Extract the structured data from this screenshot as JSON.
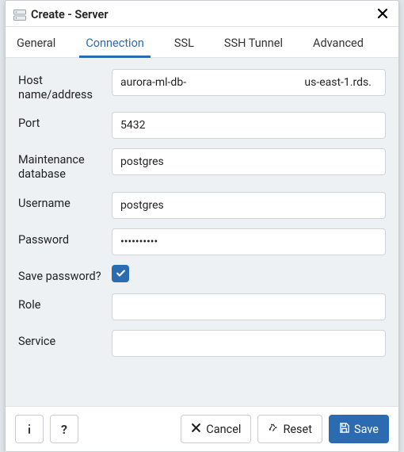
{
  "dialog": {
    "title": "Create - Server"
  },
  "tabs": [
    {
      "label": "General"
    },
    {
      "label": "Connection",
      "active": true
    },
    {
      "label": "SSL"
    },
    {
      "label": "SSH Tunnel"
    },
    {
      "label": "Advanced"
    }
  ],
  "form": {
    "host": {
      "label": "Host name/address",
      "value": "aurora-ml-db-                                           us-east-1.rds."
    },
    "port": {
      "label": "Port",
      "value": "5432"
    },
    "maintenance": {
      "label": "Maintenance database",
      "value": "postgres"
    },
    "username": {
      "label": "Username",
      "value": "postgres"
    },
    "password": {
      "label": "Password",
      "value": "••••••••••"
    },
    "savepw": {
      "label": "Save password?",
      "checked": true
    },
    "role": {
      "label": "Role",
      "value": ""
    },
    "service": {
      "label": "Service",
      "value": ""
    }
  },
  "footer": {
    "info_tooltip": "i",
    "help_tooltip": "?",
    "cancel": "Cancel",
    "reset": "Reset",
    "save": "Save"
  }
}
